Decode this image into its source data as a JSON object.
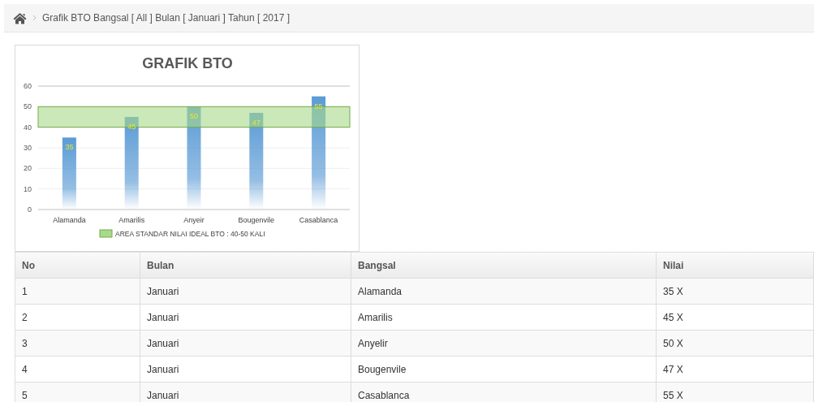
{
  "breadcrumb": {
    "text": "Grafik BTO Bangsal [ All ] Bulan [ Januari ] Tahun [ 2017 ]"
  },
  "chart": {
    "chart_data": {
      "type": "bar",
      "title": "GRAFIK BTO",
      "categories": [
        "Alamanda",
        "Amarilis",
        "Anyeir",
        "Bougenvile",
        "Casablanca"
      ],
      "series": [
        {
          "color": "#5b9bd5",
          "values": [
            35,
            45,
            50,
            47,
            55
          ]
        }
      ],
      "ylim": [
        0,
        60
      ],
      "yticks": [
        0,
        10,
        20,
        30,
        40,
        50,
        60
      ],
      "data_labels": true,
      "grid": true,
      "bands": [
        {
          "axis": "y",
          "from": 40,
          "to": 50,
          "color": "#a9d98a",
          "label": "AREA STANDAR NILAI IDEAL BTO : 40-50 KALI"
        }
      ]
    }
  },
  "table": {
    "columns": [
      "No",
      "Bulan",
      "Bangsal",
      "Nilai"
    ],
    "rows": [
      [
        "1",
        "Januari",
        "Alamanda",
        "35 X"
      ],
      [
        "2",
        "Januari",
        "Amarilis",
        "45 X"
      ],
      [
        "3",
        "Januari",
        "Anyelir",
        "50 X"
      ],
      [
        "4",
        "Januari",
        "Bougenvile",
        "47 X"
      ],
      [
        "5",
        "Januari",
        "Casablanca",
        "55 X"
      ]
    ]
  }
}
